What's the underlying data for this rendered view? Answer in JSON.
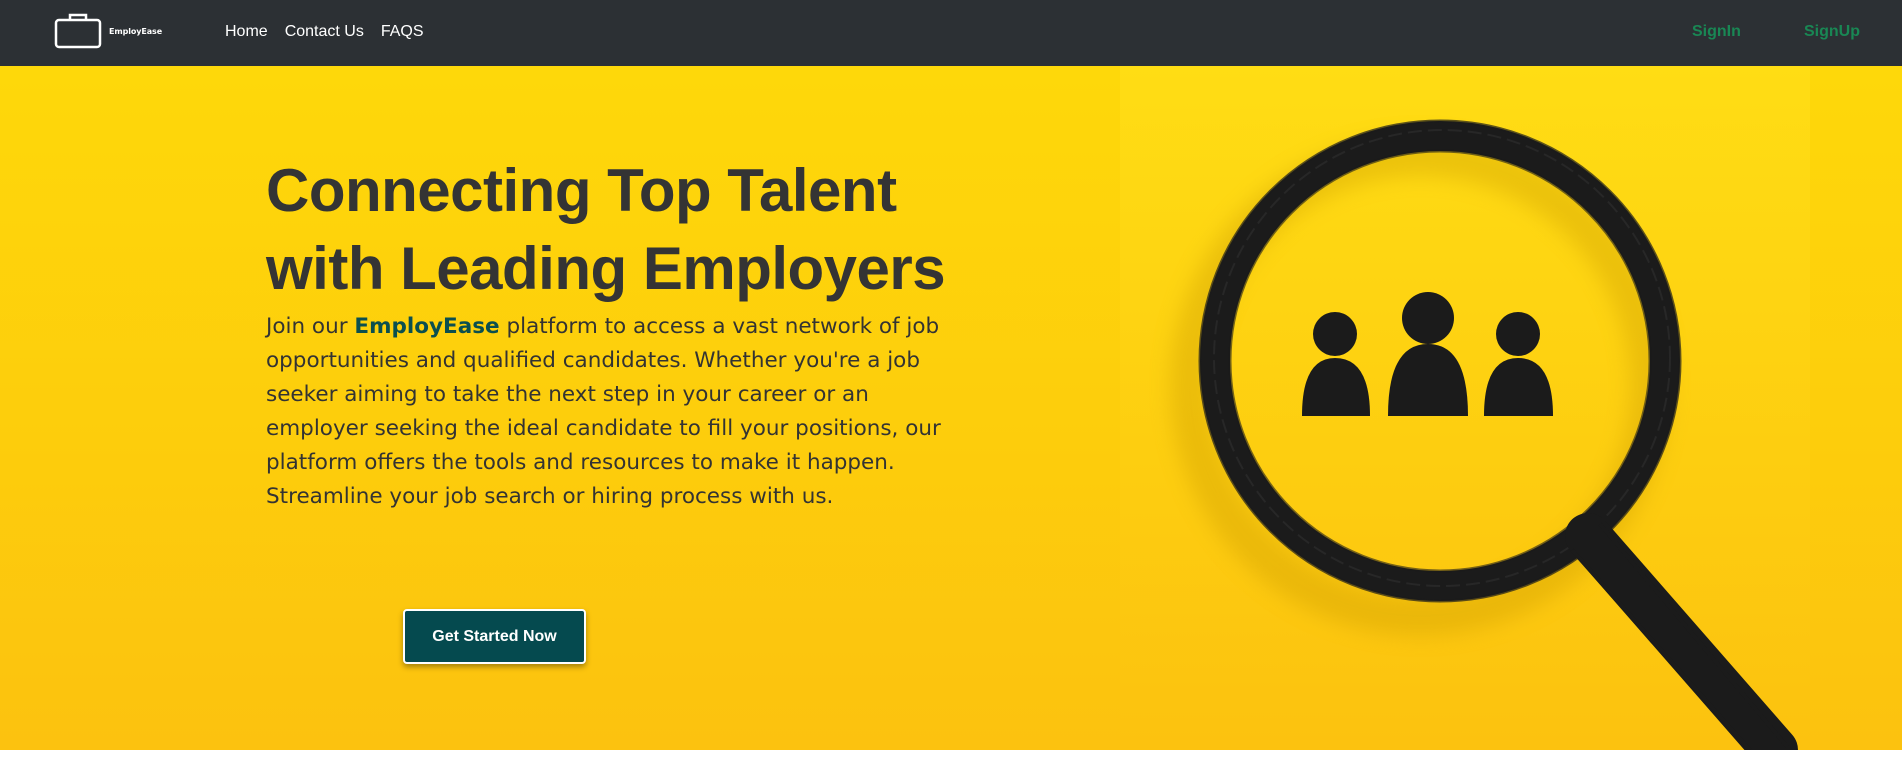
{
  "navbar": {
    "brand_name": "EmployEase",
    "logo_icon": "briefcase-icon",
    "links": [
      {
        "label": "Home"
      },
      {
        "label": "Contact Us"
      },
      {
        "label": "FAQS"
      }
    ],
    "signin_label": "SignIn",
    "signup_label": "SignUp",
    "bg_color": "#2c3034",
    "auth_color": "#198754"
  },
  "hero": {
    "headline_line1": "Connecting Top Talent",
    "headline_line2": "with Leading Employers",
    "lead_before": "Join our ",
    "lead_brand": "EmployEase",
    "lead_after": " platform to access a vast network of job opportunities and qualified candidates. Whether you're a job seeker aiming to take the next step in your career or an employer seeking the ideal candidate to fill your positions, our platform offers the tools and resources to make it happen. Streamline your job search or hiring process with us.",
    "cta_label": "Get Started Now",
    "image_icon": "magnifying-glass-people-icon",
    "bg_color": "#fdcf0c",
    "cta_color": "#054a4f"
  }
}
